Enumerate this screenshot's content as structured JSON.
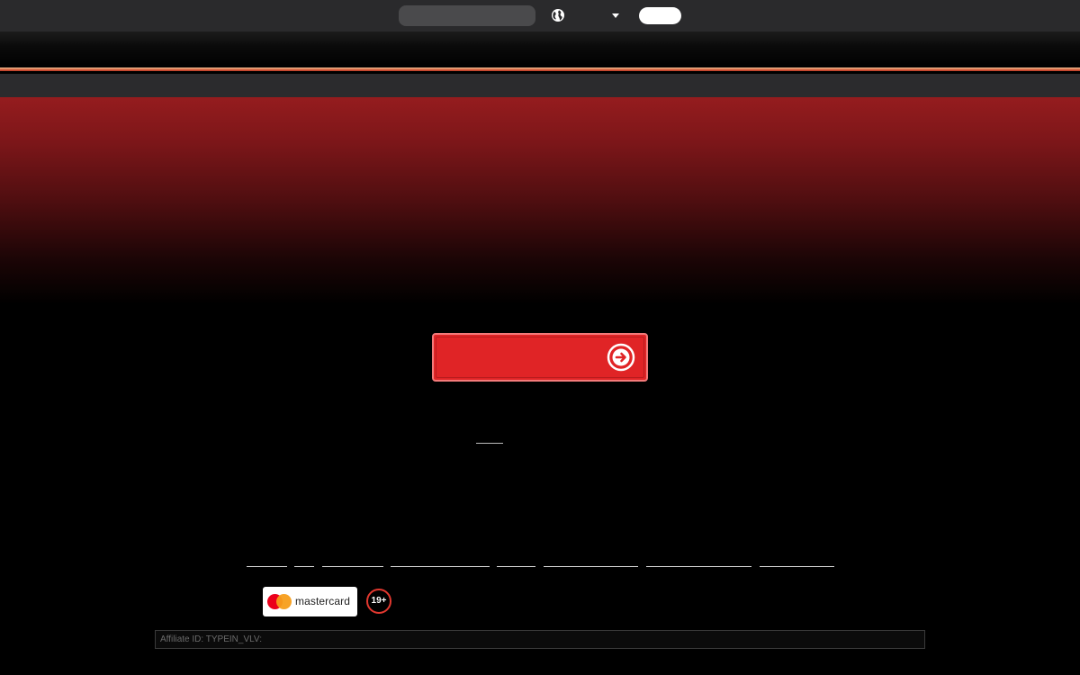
{
  "topbar": {
    "search": {
      "value": "",
      "placeholder": ""
    },
    "language": {
      "icon": "globe-icon",
      "selected": "",
      "dropdown_icon": "caret-down-icon"
    },
    "login": {
      "label": ""
    }
  },
  "hero": {
    "cta": {
      "label": "",
      "icon": "arrow-right-circle-icon",
      "color": "#e02426"
    },
    "secondary_link": {
      "label": ""
    }
  },
  "footer": {
    "links": [
      {
        "label": ""
      },
      {
        "label": ""
      },
      {
        "label": ""
      },
      {
        "label": ""
      },
      {
        "label": ""
      },
      {
        "label": ""
      },
      {
        "label": ""
      },
      {
        "label": ""
      }
    ],
    "payment": {
      "name": "mastercard",
      "icon": "mastercard-logo-icon"
    },
    "age_limit": "19+",
    "affiliate_text": "Affiliate ID: TYPEIN_VLV:"
  },
  "colors": {
    "accent_red": "#e02426",
    "hero_top": "#951c1e",
    "topbar_bg": "#2a2a2c",
    "navbar_bg": "#2b2b2d"
  }
}
